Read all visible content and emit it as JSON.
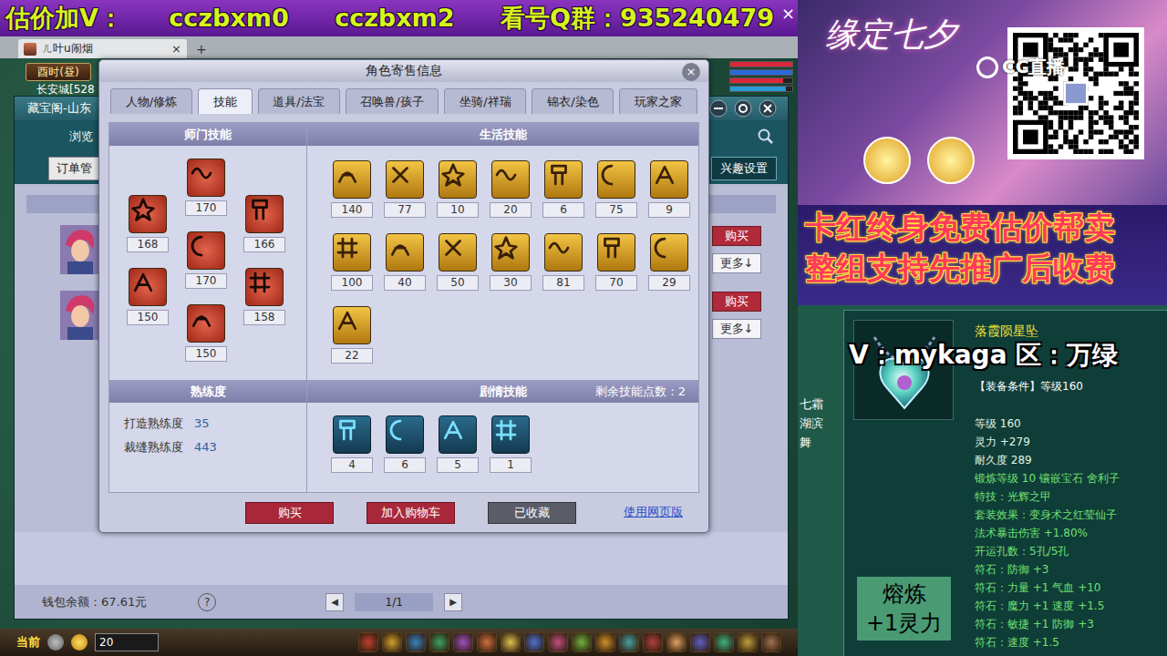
{
  "banner": {
    "segments": [
      "估价加V：",
      "cczbxm0",
      "cczbxm2",
      "看号Q群：935240479"
    ],
    "close": "×"
  },
  "browser_tab": {
    "title": "ㄦ叶u闹烟",
    "close": "×",
    "new_tab": "+"
  },
  "hud": {
    "time": "酉时(昼)",
    "location": "长安城[528",
    "bars": [
      {
        "level": 1,
        "color": "#d8283a"
      },
      {
        "level": 1,
        "color": "#2a6ad8"
      },
      {
        "level": 0.85,
        "color": "#d8283a"
      },
      {
        "level": 0.9,
        "color": "#2a9ad8"
      }
    ]
  },
  "market_window": {
    "title": "藏宝阁-山东",
    "browse": "浏览",
    "order_button": "订单管",
    "interest_button": "兴趣设置",
    "rows": [
      {
        "buy": "购买",
        "more": "更多↓"
      },
      {
        "buy": "购买",
        "more": "更多↓"
      }
    ],
    "wallet": "钱包余额：67.61元",
    "help": "?",
    "prev": "◀",
    "page": "1/1",
    "next": "▶"
  },
  "dialog": {
    "title": "角色寄售信息",
    "close": "×",
    "tabs": [
      {
        "label": "人物/修炼",
        "selected": false
      },
      {
        "label": "技能",
        "selected": true
      },
      {
        "label": "道具/法宝",
        "selected": false
      },
      {
        "label": "召唤兽/孩子",
        "selected": false
      },
      {
        "label": "坐骑/祥瑞",
        "selected": false
      },
      {
        "label": "锦衣/染色",
        "selected": false
      },
      {
        "label": "玩家之家",
        "selected": false
      }
    ],
    "school_skills": {
      "header": "师门技能",
      "levels": [
        "168",
        "170",
        "166",
        "170",
        "150",
        "158",
        "150"
      ]
    },
    "life_skills": {
      "header": "生活技能",
      "levels": [
        "140",
        "77",
        "10",
        "20",
        "6",
        "75",
        "9",
        "100",
        "40",
        "50",
        "30",
        "81",
        "70",
        "29",
        "22"
      ]
    },
    "proficiency": {
      "header": "熟练度",
      "items": [
        {
          "label": "打造熟练度",
          "value": "35"
        },
        {
          "label": "裁缝熟练度",
          "value": "443"
        }
      ]
    },
    "story_skills": {
      "header": "剧情技能",
      "remaining_label": "剩余技能点数：",
      "remaining": "2",
      "levels": [
        "4",
        "6",
        "5",
        "1"
      ]
    },
    "buttons": [
      {
        "label": "购买",
        "kind": "primary"
      },
      {
        "label": "加入购物车",
        "kind": "primary"
      },
      {
        "label": "已收藏",
        "kind": "done"
      },
      {
        "label": "使用网页版",
        "kind": "link"
      }
    ]
  },
  "chat_bar": {
    "channel": "当前",
    "count": "20"
  },
  "ad": {
    "title": "缘定七夕",
    "logo": "CC直播"
  },
  "promo": [
    "卡红终身免费估价帮卖",
    "整组支持先推广后收费"
  ],
  "contact": "V：mykaga  区：万绿",
  "side_names": [
    "七霜",
    "湖滨",
    "舞"
  ],
  "item": {
    "name": "落霞陨星坠",
    "requirement": "【装备条件】等级160",
    "stats": [
      {
        "text": "等级 160",
        "kind": "base"
      },
      {
        "text": "灵力 +279",
        "kind": "base"
      },
      {
        "text": "耐久度 289",
        "kind": "base"
      },
      {
        "text": "锻炼等级 10 镶嵌宝石 舍利子",
        "kind": "green"
      },
      {
        "text": "特技：光辉之甲",
        "kind": "green"
      },
      {
        "text": "套装效果：变身术之红莹仙子",
        "kind": "green"
      },
      {
        "text": "法术暴击伤害 +1.80%",
        "kind": "green"
      },
      {
        "text": "开运孔数：5孔/5孔",
        "kind": "green"
      },
      {
        "text": "符石：防御 +3",
        "kind": "green"
      },
      {
        "text": "符石：力量 +1 气血 +10",
        "kind": "green"
      },
      {
        "text": "符石：魔力 +1 速度 +1.5",
        "kind": "green"
      },
      {
        "text": "符石：敏捷 +1 防御 +3",
        "kind": "green"
      },
      {
        "text": "符石：速度 +1.5",
        "kind": "green"
      }
    ]
  },
  "smelt": [
    "熔炼",
    "+1灵力"
  ]
}
